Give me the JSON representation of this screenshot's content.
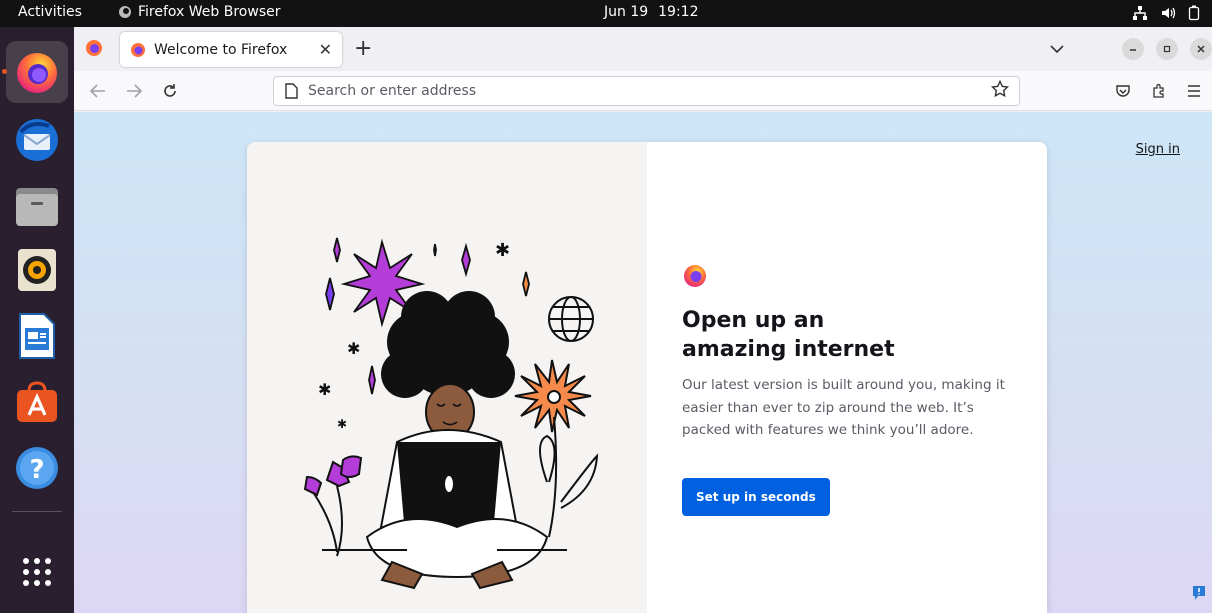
{
  "topbar": {
    "activities": "Activities",
    "app_name": "Firefox Web Browser",
    "date": "Jun 19",
    "time": "19:12"
  },
  "dock": {
    "items": [
      "Firefox",
      "Thunderbird",
      "Files",
      "Rhythmbox",
      "LibreOffice Writer",
      "Ubuntu Software",
      "Help",
      "Show Applications"
    ]
  },
  "browser": {
    "tab_title": "Welcome to Firefox",
    "url_placeholder": "Search or enter address"
  },
  "page": {
    "sign_in": "Sign in",
    "headline": "Open up an amazing internet",
    "subtext": "Our latest version is built around you, making it easier than ever to zip around the web. It’s packed with features we think you’ll adore.",
    "cta": "Set up in seconds"
  },
  "colors": {
    "accent": "#0061e0",
    "ubuntu_orange": "#e95420",
    "illustration_purple": "#b43cd8",
    "illustration_orange": "#f58a4b"
  }
}
